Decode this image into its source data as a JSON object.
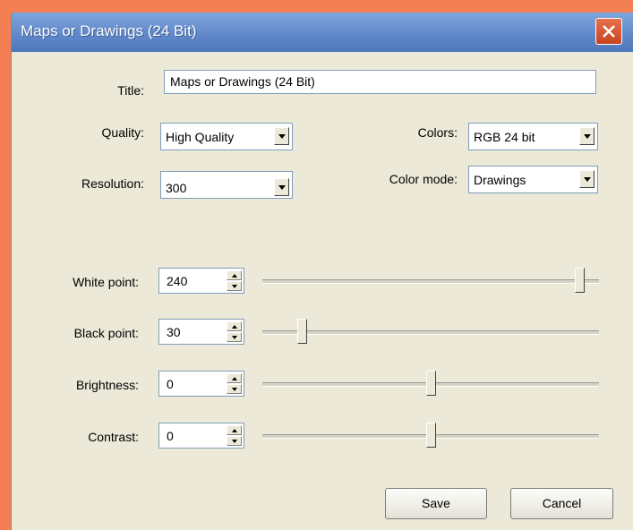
{
  "window": {
    "title": "Maps or Drawings (24 Bit)"
  },
  "form": {
    "title_label": "Title:",
    "title_value": "Maps or Drawings (24 Bit)",
    "quality_label": "Quality:",
    "quality_value": "High Quality",
    "colors_label": "Colors:",
    "colors_value": "RGB 24 bit",
    "resolution_label": "Resolution:",
    "resolution_value": "300",
    "color_mode_label": "Color mode:",
    "color_mode_value": "Drawings"
  },
  "sliders": [
    {
      "label": "White point:",
      "value": "240",
      "min": 0,
      "max": 255
    },
    {
      "label": "Black point:",
      "value": "30",
      "min": 0,
      "max": 255
    },
    {
      "label": "Brightness:",
      "value": "0",
      "min": -100,
      "max": 100
    },
    {
      "label": "Contrast:",
      "value": "0",
      "min": -100,
      "max": 100
    }
  ],
  "buttons": {
    "save": "Save",
    "cancel": "Cancel"
  },
  "icons": {
    "close": "close-icon",
    "dropdown": "chevron-down-icon",
    "spin_up": "spin-up-icon",
    "spin_down": "spin-down-icon"
  },
  "colors": {
    "titlebar": "#5f87c8",
    "background": "#f47f52",
    "dialog": "#ece9d8",
    "close_button": "#c8451f"
  }
}
